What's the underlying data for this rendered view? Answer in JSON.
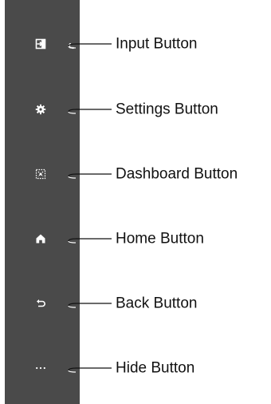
{
  "panel": {
    "background": "#4a4a4a",
    "icon_color": "#ffffff"
  },
  "callouts": [
    {
      "label": "Input Button",
      "icon": "input-icon"
    },
    {
      "label": "Settings Button",
      "icon": "gear-icon"
    },
    {
      "label": "Dashboard Button",
      "icon": "dashboard-icon"
    },
    {
      "label": "Home Button",
      "icon": "home-icon"
    },
    {
      "label": "Back Button",
      "icon": "back-icon"
    },
    {
      "label": "Hide Button",
      "icon": "more-icon"
    }
  ]
}
